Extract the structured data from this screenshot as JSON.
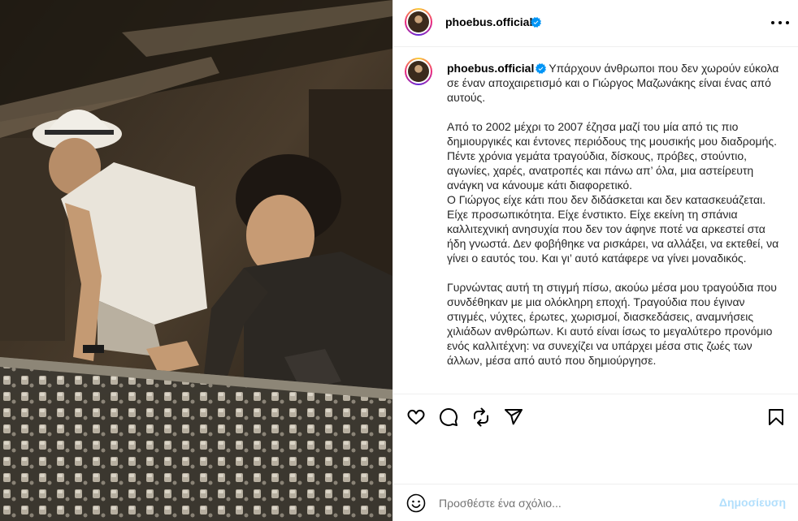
{
  "post": {
    "username": "phoebus.official",
    "verified_icon": "verified-badge-icon",
    "accent_color": "#0095f6",
    "photo_description_icon": "studio-photo"
  },
  "caption": {
    "username": "phoebus.official",
    "paragraph1": "Υπάρχουν άνθρωποι που δεν χωρούν εύκολα σε έναν αποχαιρετισμό και ο Γιώργος Μαζωνάκης είναι ένας από αυτούς.",
    "paragraph2": "Από το 2002 μέχρι το 2007 έζησα μαζί του μία από τις πιο δημιουργικές και έντονες περιόδους της μουσικής μου διαδρομής. Πέντε χρόνια γεμάτα τραγούδια, δίσκους, πρόβες, στούντιο, αγωνίες, χαρές, ανατροπές και πάνω απ’ όλα, μια αστείρευτη ανάγκη να κάνουμε κάτι διαφορετικό.",
    "paragraph3": "Ο Γιώργος είχε κάτι που δεν διδάσκεται και δεν κατασκευάζεται. Είχε προσωπικότητα. Είχε ένστικτο. Είχε εκείνη τη σπάνια καλλιτεχνική ανησυχία που δεν τον άφηνε ποτέ να αρκεστεί στα ήδη γνωστά. Δεν φοβήθηκε να ρισκάρει, να αλλάξει, να εκτεθεί, να γίνει ο εαυτός του. Και γι’ αυτό κατάφερε να γίνει μοναδικός.",
    "paragraph4": "Γυρνώντας αυτή τη στιγμή πίσω, ακούω μέσα μου τραγούδια που συνδέθηκαν με μια ολόκληρη εποχή. Τραγούδια που έγιναν στιγμές, νύχτες, έρωτες, χωρισμοί, διασκεδάσεις, αναμνήσεις χιλιάδων ανθρώπων. Κι αυτό είναι ίσως το μεγαλύτερο προνόμιο ενός καλλιτέχνη: να συνεχίζει να υπάρχει μέσα στις ζωές των άλλων, μέσα από αυτό που δημιούργησε."
  },
  "actions": {
    "like_icon": "heart-icon",
    "comment_icon": "comment-icon",
    "repost_icon": "repost-icon",
    "share_icon": "send-icon",
    "save_icon": "bookmark-icon"
  },
  "comment": {
    "placeholder": "Προσθέστε ένα σχόλιο...",
    "post_label": "Δημοσίευση",
    "emoji_icon": "emoji-icon"
  }
}
